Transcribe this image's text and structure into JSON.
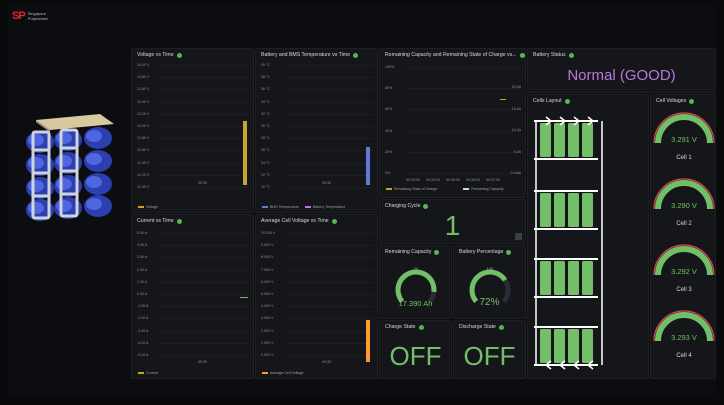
{
  "brand": {
    "logo_mark": "SP",
    "logo_text": "Singapore Polytechnic"
  },
  "colors": {
    "green": "#73bf69",
    "yellow": "#c7a52a",
    "blue": "#5f7bd6",
    "orange": "#ff9830",
    "panel": "#151619"
  },
  "panels": {
    "voltage": {
      "title": "Voltage vs Time",
      "y_ticks": [
        "14.00 V",
        "13.80 V",
        "13.60 V",
        "13.40 V",
        "13.20 V",
        "13.00 V",
        "12.80 V",
        "12.60 V",
        "12.40 V",
        "12.20 V",
        "12.00 V"
      ],
      "x_tick": "09:35",
      "legend": [
        "Voltage"
      ]
    },
    "temperature": {
      "title": "Battery and BMS Temperature vs Time",
      "y_ticks": [
        "40 °C",
        "38 °C",
        "36 °C",
        "34 °C",
        "32 °C",
        "30 °C",
        "28 °C",
        "26 °C",
        "24 °C",
        "22 °C",
        "20 °C"
      ],
      "x_tick": "09:35",
      "legend": [
        "BMS Temperature",
        "Battery Temperature"
      ]
    },
    "capacity_chart": {
      "title": "Remaining Capacity and Remaining State of Charge vs...",
      "y_ticks_left": [
        "100%",
        "80%",
        "60%",
        "40%",
        "20%",
        "0%"
      ],
      "y_ticks_right": [
        "20 Ah",
        "15 Ah",
        "10 Ah",
        "5 Ah",
        "0 mAh"
      ],
      "x_ticks": [
        "09:33:00",
        "09:34:00",
        "09:35:00",
        "09:36:00",
        "09:37:00"
      ],
      "legend": [
        "Remaining State of Charge",
        "Remaining Capacity"
      ]
    },
    "current": {
      "title": "Current vs Time",
      "y_ticks": [
        "5.00 A",
        "4.00 A",
        "3.00 A",
        "2.00 A",
        "1.00 A",
        "0.00 A",
        "-1.00 A",
        "-2.00 A",
        "-3.00 A",
        "-4.00 A",
        "-5.00 A"
      ],
      "x_tick": "09:35",
      "legend": [
        "Current"
      ]
    },
    "cell_voltage": {
      "title": "Average Cell Voltage vs Time",
      "y_ticks": [
        "10.000 V",
        "9.000 V",
        "8.000 V",
        "7.000 V",
        "6.000 V",
        "5.000 V",
        "4.000 V",
        "3.000 V",
        "2.000 V",
        "1.000 V",
        "0.000 V"
      ],
      "x_tick": "09:35",
      "legend": [
        "Average Cell Voltage"
      ]
    },
    "charging_cycle": {
      "title": "Charging Cycle",
      "value": "1"
    },
    "remaining_capacity": {
      "title": "Remaining Capacity",
      "value": "17.390 Ah",
      "gauge_max": "20",
      "fraction": 0.87
    },
    "battery_percentage": {
      "title": "Battery Percentage",
      "value": "72%",
      "gauge_max": "100",
      "fraction": 0.72
    },
    "charge_state": {
      "title": "Charge State",
      "value": "OFF"
    },
    "discharge_state": {
      "title": "Discharge State",
      "value": "OFF"
    },
    "battery_status": {
      "title": "Battery Status",
      "value": "Normal (GOOD)"
    },
    "cells_layout": {
      "title": "Cells Layout"
    },
    "cell_voltages": {
      "title": "Cell Voltages",
      "cells": [
        {
          "name": "Cell 1",
          "value": "3.291 V"
        },
        {
          "name": "Cell 2",
          "value": "3.290 V"
        },
        {
          "name": "Cell 3",
          "value": "3.292 V"
        },
        {
          "name": "Cell 4",
          "value": "3.293 V"
        }
      ]
    }
  }
}
